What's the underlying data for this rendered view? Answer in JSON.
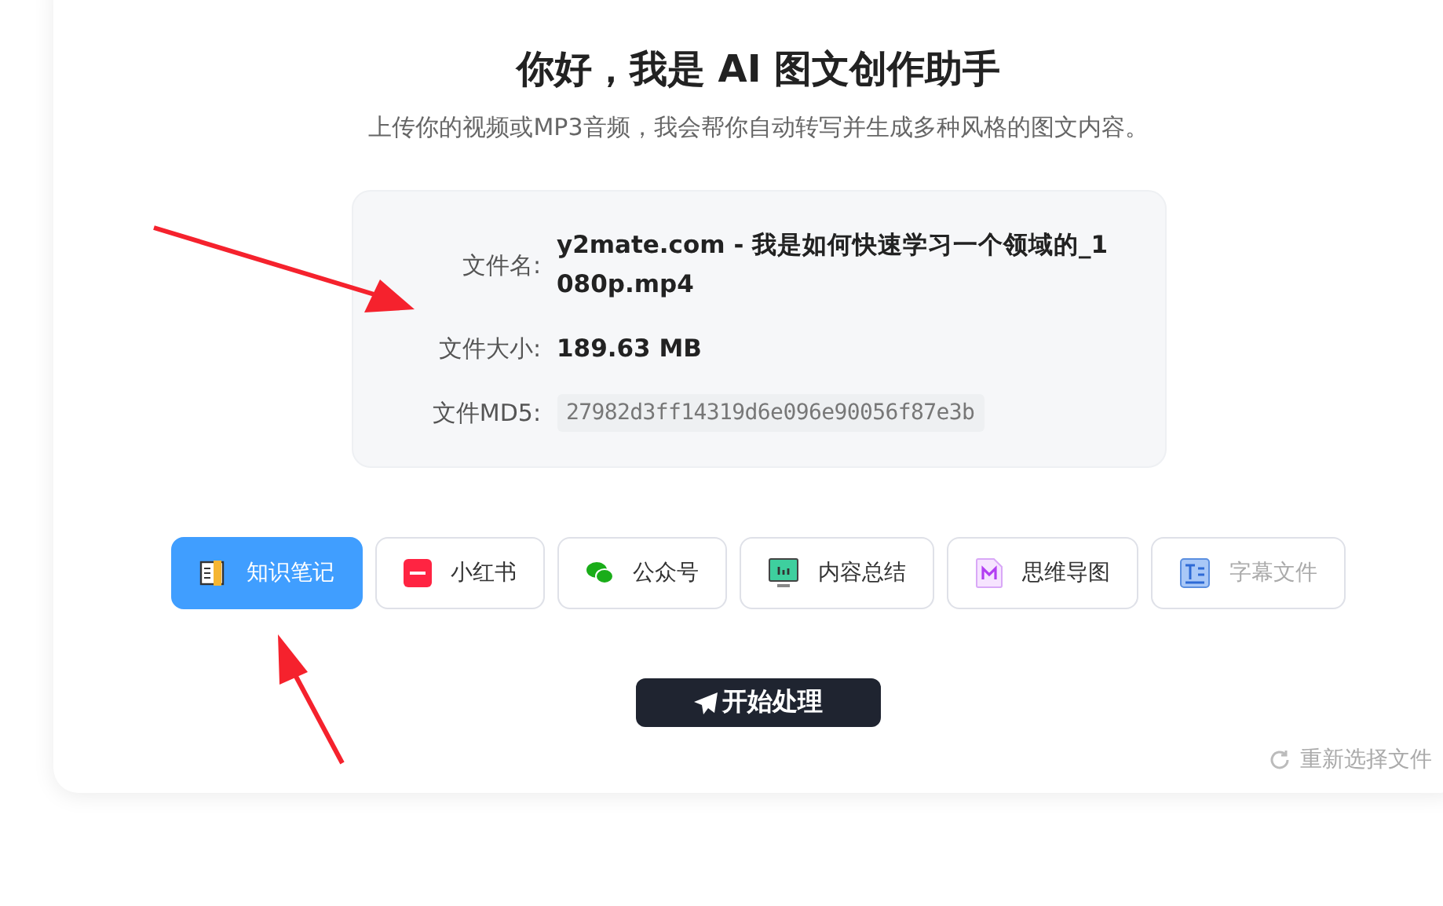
{
  "title": "你好，我是 AI 图文创作助手",
  "subtitle": "上传你的视频或MP3音频，我会帮你自动转写并生成多种风格的图文内容。",
  "file_info": [
    {
      "label": "文件名:",
      "value": "y2mate.com - 我是如何快速学习一个领域的_1080p.mp4",
      "kind": "text"
    },
    {
      "label": "文件大小:",
      "value": "189.63 MB",
      "kind": "text"
    },
    {
      "label": "文件MD5:",
      "value": "27982d3ff14319d6e096e90056f87e3b",
      "kind": "code"
    }
  ],
  "options": [
    {
      "label": "知识笔记",
      "kind": "note",
      "selected": true,
      "disabled": false
    },
    {
      "label": "小红书",
      "kind": "xhs",
      "selected": false,
      "disabled": false
    },
    {
      "label": "公众号",
      "kind": "wechat",
      "selected": false,
      "disabled": false
    },
    {
      "label": "内容总结",
      "kind": "summary",
      "selected": false,
      "disabled": false
    },
    {
      "label": "思维导图",
      "kind": "mindmap",
      "selected": false,
      "disabled": false
    },
    {
      "label": "字幕文件",
      "kind": "subtitle",
      "selected": false,
      "disabled": true
    }
  ],
  "start_button": "开始处理",
  "reselect_link": "重新选择文件"
}
